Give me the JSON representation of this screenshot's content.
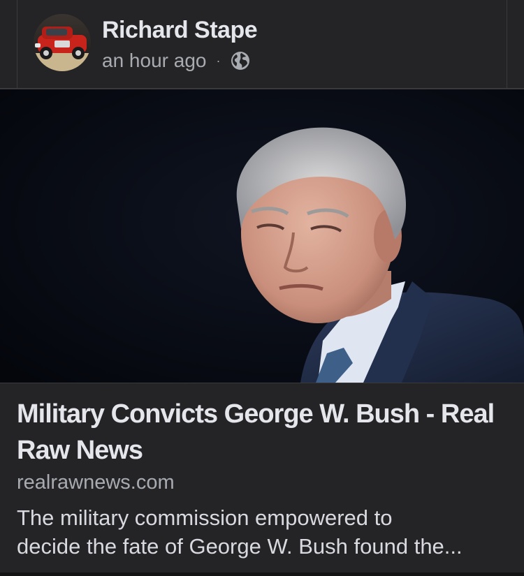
{
  "post": {
    "author_name": "Richard Stape",
    "timestamp": "an hour ago",
    "separator": "·",
    "audience_icon": "globe-icon"
  },
  "link_preview": {
    "title": "Military Convicts George W. Bush - Real Raw News",
    "domain": "realrawnews.com",
    "description_line1": "The military commission empowered to",
    "description_line2": "decide the fate of George W. Bush found the..."
  },
  "colors": {
    "background": "#1c1c1e",
    "card": "#242426",
    "primary_text": "#e4e6eb",
    "secondary_text": "#a8abb0"
  }
}
